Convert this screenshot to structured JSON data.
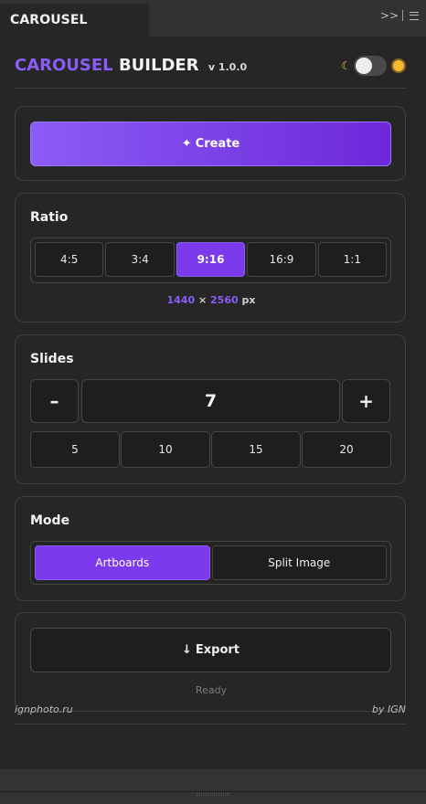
{
  "tab": {
    "title": "CAROUSEL BUILDER"
  },
  "header": {
    "title_accent": "CAROUSEL",
    "title_main": "BUILDER",
    "version": "v 1.0.0"
  },
  "create": {
    "label": "Create",
    "icon": "sparkle-icon"
  },
  "ratio": {
    "title": "Ratio",
    "options": [
      "4:5",
      "3:4",
      "9:16",
      "16:9",
      "1:1"
    ],
    "selected": "9:16",
    "width": "1440",
    "times": "×",
    "height": "2560",
    "unit": "px"
  },
  "slides": {
    "title": "Slides",
    "minus": "–",
    "plus": "+",
    "value": "7",
    "presets": [
      "5",
      "10",
      "15",
      "20"
    ]
  },
  "mode": {
    "title": "Mode",
    "options": [
      "Artboards",
      "Split Image"
    ],
    "selected": "Artboards"
  },
  "export": {
    "label": "Export",
    "arrow": "↓",
    "status": "Ready"
  },
  "footer": {
    "site": "ignphoto.ru",
    "credit": "by IGN"
  },
  "colors": {
    "accent": "#7c3aed",
    "accent_light": "#8b5cf6",
    "panel_bg": "#262626"
  }
}
